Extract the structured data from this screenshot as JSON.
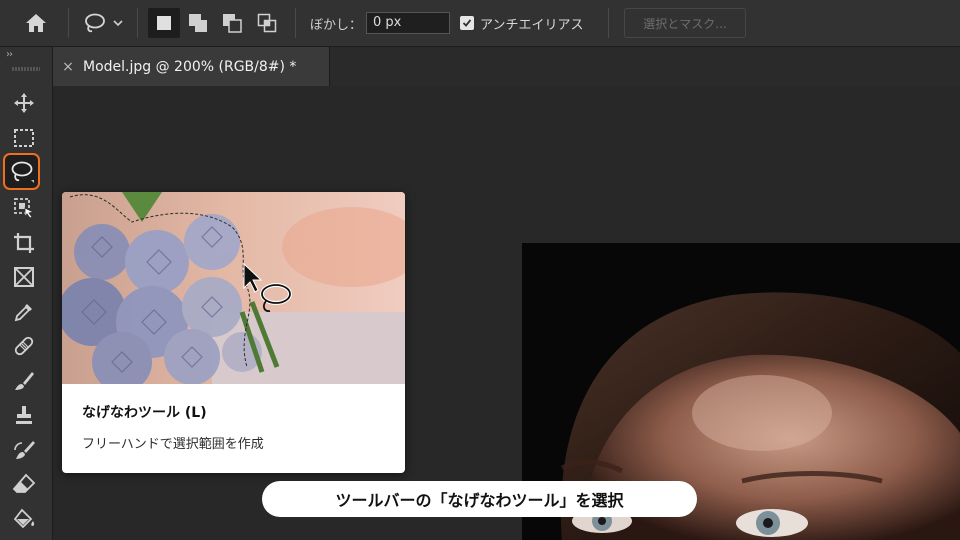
{
  "options_bar": {
    "home_icon": "home-icon",
    "lasso_preset_icon": "lasso-icon",
    "selection_modes": [
      "new-selection-icon",
      "add-to-selection-icon",
      "subtract-from-selection-icon",
      "intersect-selection-icon"
    ],
    "feather_label": "ぼかし：",
    "feather_value": "0 px",
    "anti_alias_label": "アンチエイリアス",
    "anti_alias_checked": true,
    "select_mask_label": "選択とマスク..."
  },
  "toolbar": {
    "collapse_glyph": "››",
    "tools": [
      "move-tool-icon",
      "marquee-tool-icon",
      "lasso-tool-icon",
      "object-selection-tool-icon",
      "crop-tool-icon",
      "frame-tool-icon",
      "eyedropper-tool-icon",
      "healing-brush-tool-icon",
      "brush-tool-icon",
      "clone-stamp-tool-icon",
      "history-brush-tool-icon",
      "eraser-tool-icon",
      "paint-bucket-tool-icon"
    ],
    "selected_tool": "lasso-tool-icon",
    "accent_color": "#f06e1e"
  },
  "document_tab": {
    "close_glyph": "×",
    "title": "Model.jpg @ 200% (RGB/8#) *"
  },
  "tooltip": {
    "title": "なげなわツール (L)",
    "description": "フリーハンドで選択範囲を作成"
  },
  "caption": "ツールバーの「なげなわツール」を選択"
}
